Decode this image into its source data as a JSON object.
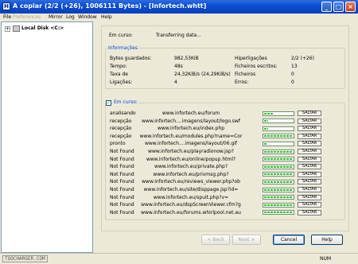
{
  "window": {
    "title": "A copiar (2/2 (+26), 1006111 Bytes) - [Infortech.whtt]",
    "icon_letter": "H"
  },
  "menu": [
    "File",
    "Preferences",
    "Mirror",
    "Log",
    "Window",
    "Help"
  ],
  "tree": {
    "expander": "+",
    "drive_label": "Local Disk <C:>"
  },
  "status": {
    "label": "Em curso:",
    "value": "Transferring data..."
  },
  "info": {
    "title": "Informações",
    "left": [
      {
        "label": "Bytes guardados:",
        "value": "982,53KiB"
      },
      {
        "label": "Tempo:",
        "value": "48s"
      },
      {
        "label": "Taxa de",
        "value": "24,32KiB/s (24,29KiB/s)"
      },
      {
        "label": "Ligações:",
        "value": "4"
      }
    ],
    "right": [
      {
        "label": "Hiperligações",
        "value": "2/2 (+26)"
      },
      {
        "label": "Ficheiros escritos:",
        "value": "13"
      },
      {
        "label": "Ficheiros",
        "value": "0"
      },
      {
        "label": "Erros:",
        "value": "0"
      }
    ]
  },
  "transfers": {
    "title": "Em curso:",
    "checked": true,
    "stop_label": "SALTAR",
    "rows": [
      {
        "status": "analisando",
        "url": "www.infortech.eu/forum",
        "progress": 0.3
      },
      {
        "status": "recepção",
        "url": "www.infortech....imagens/layout/logo.swf",
        "progress": 0.15
      },
      {
        "status": "recepção",
        "url": "www.infortech.eu/index.php",
        "progress": 0.15
      },
      {
        "status": "recepção",
        "url": "www.infortech.eu/modules.php?name=Cor",
        "progress": 1.0
      },
      {
        "status": "pronto",
        "url": "www.infortech....imagens/layout/06.gif",
        "progress": 0.08
      },
      {
        "status": "Not Found",
        "url": "www.infortech.eu/playradionow.jsp?",
        "progress": 1.0
      },
      {
        "status": "Not Found",
        "url": "www.infortech.eu/online/popup.html?",
        "progress": 1.0
      },
      {
        "status": "Not Found",
        "url": "www.infortech.eu/private.php?",
        "progress": 1.0
      },
      {
        "status": "Not Found",
        "url": "www.infortech.eu/privmsg.php?",
        "progress": 1.0
      },
      {
        "status": "Not Found",
        "url": "www.infortech.eu/reviews_viewer.php?ob",
        "progress": 1.0
      },
      {
        "status": "Not Found",
        "url": "www.infortech.eu/site/disppage.jsp?id=",
        "progress": 1.0
      },
      {
        "status": "Not Found",
        "url": "www.infortech.eu/spuit.php?v=",
        "progress": 1.0
      },
      {
        "status": "Not Found",
        "url": "www.infortech.eu/dspScreenViewer.cfm?g",
        "progress": 1.0
      },
      {
        "status": "Not Found",
        "url": "www.infortech.eu/forums.whirlpool.net.au",
        "progress": 1.0
      }
    ]
  },
  "buttons": {
    "back": "< Back",
    "next": "Next >",
    "cancel": "Cancel",
    "help": "Help"
  },
  "statusbar": {
    "watermark": "TOOCHARGER.COM",
    "num": "NUM"
  }
}
